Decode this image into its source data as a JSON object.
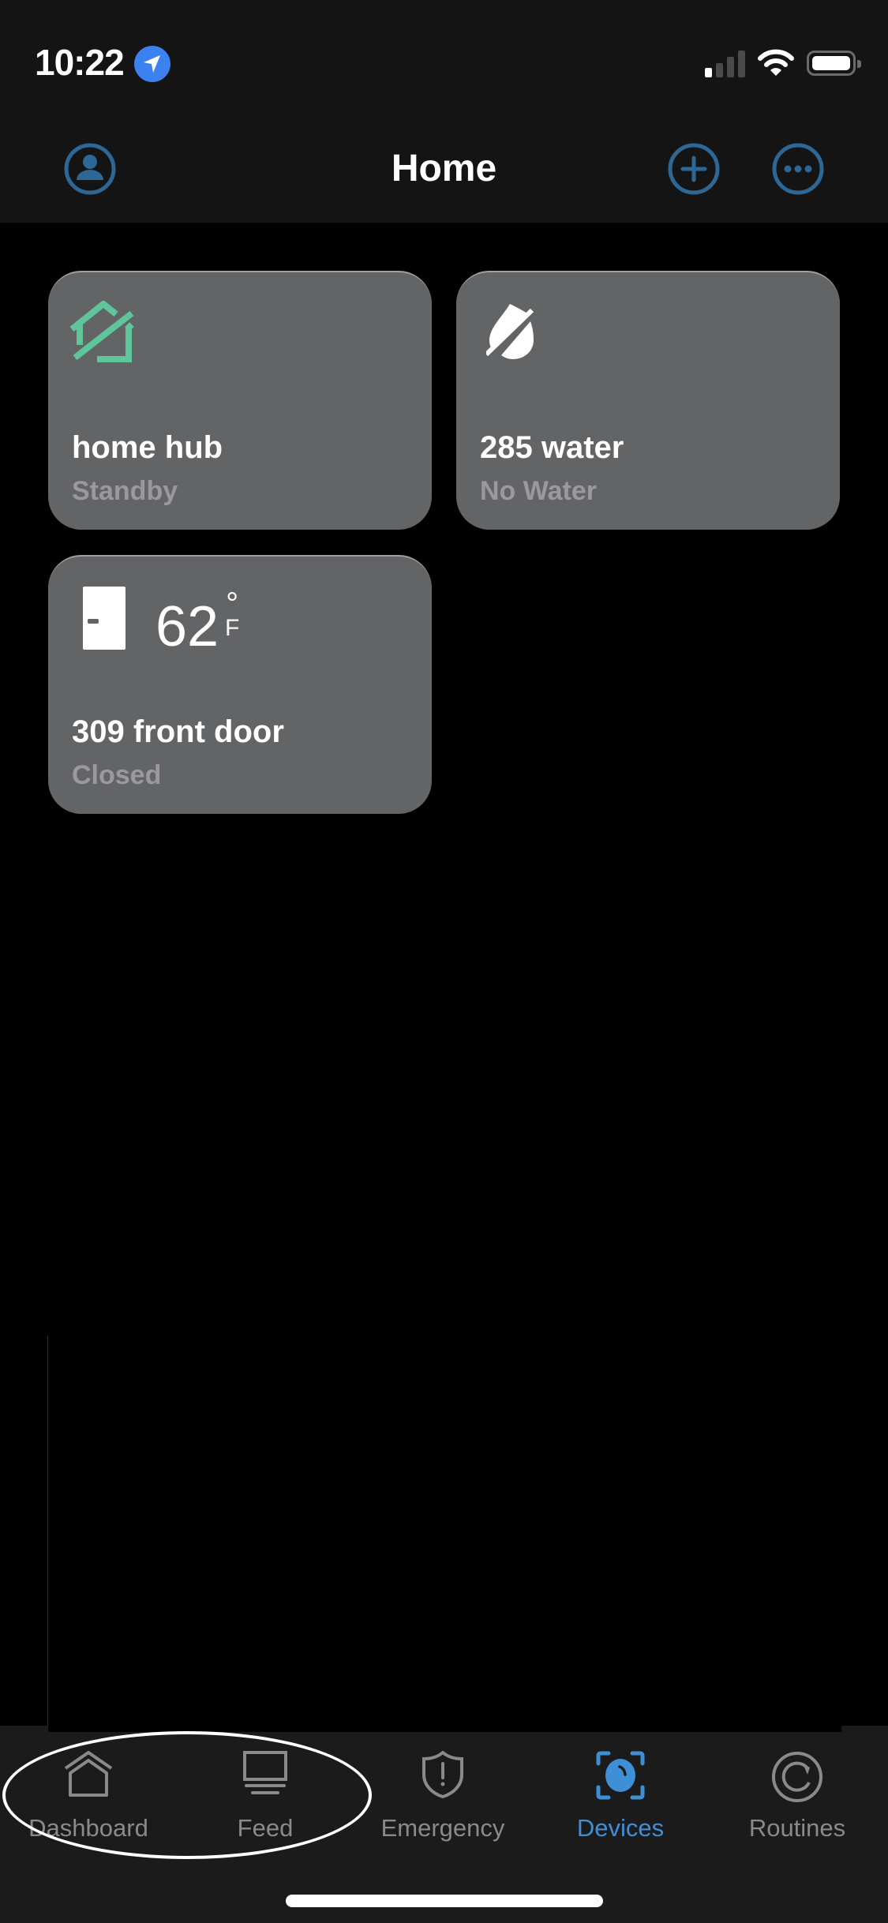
{
  "status_bar": {
    "time": "10:22",
    "location_icon": "location-arrow-icon",
    "signal_icon": "cellular-signal-icon",
    "wifi_icon": "wifi-icon",
    "battery_icon": "battery-full-icon"
  },
  "header": {
    "title": "Home",
    "left_button_icon": "profile-icon",
    "add_button_icon": "plus-circle-icon",
    "more_button_icon": "ellipsis-circle-icon"
  },
  "devices": [
    {
      "name": "home hub",
      "status": "Standby",
      "icon": "home-hub-offline-icon",
      "icon_color": "#5ec69a"
    },
    {
      "name": "285 water",
      "status": "No Water",
      "icon": "water-off-icon",
      "icon_color": "#ffffff"
    },
    {
      "name": "309 front door",
      "status": "Closed",
      "icon": "door-closed-icon",
      "temperature": "62",
      "temperature_degree": "°",
      "temperature_unit": "F"
    }
  ],
  "tab_bar": {
    "tabs": [
      {
        "label": "Dashboard",
        "icon": "house-icon",
        "active": false
      },
      {
        "label": "Feed",
        "icon": "monitor-icon",
        "active": false
      },
      {
        "label": "Emergency",
        "icon": "shield-alert-icon",
        "active": false
      },
      {
        "label": "Devices",
        "icon": "devices-camera-icon",
        "active": true
      },
      {
        "label": "Routines",
        "icon": "refresh-circle-icon",
        "active": false
      }
    ]
  },
  "colors": {
    "accent": "#2c6796",
    "active_tab": "#3f8fd6",
    "inactive_tab": "#8a8a8a",
    "card_bg": "#636466",
    "header_bg": "#141414",
    "tabbar_bg": "#1b1b1b",
    "hub_green": "#5ec69a",
    "location_blue": "#3b82f0"
  }
}
